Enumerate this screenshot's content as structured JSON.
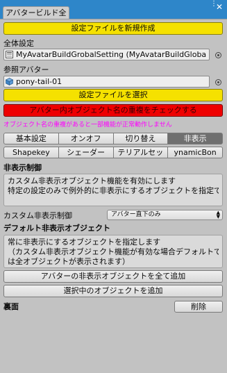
{
  "window": {
    "tab_title": "アバタービルド全",
    "close_glyph": "✕",
    "menu_glyph": "⋮"
  },
  "general": {
    "section_label": "全体設定",
    "new_settings_button": "設定ファイルを新規作成",
    "settings_file_value": "MyAvatarBuildGrobalSetting (MyAvatarBuildGloba"
  },
  "avatar": {
    "section_label": "参照アバター",
    "avatar_value": "pony-tail-01",
    "select_settings_button": "設定ファイルを選択",
    "check_duplicate_button": "アバター内オブジェクト名の重複をチェックする",
    "warning_text": "オブジェクト名の重複があると一部機能が正常動作しません"
  },
  "tabs_row1": [
    "基本設定",
    "オンオフ",
    "切り替え",
    "非表示"
  ],
  "tabs_row2": [
    "Shapekey",
    "シェーダー",
    "テリアルセッ",
    "ynamicBon"
  ],
  "active_tab": "非表示",
  "hide_control": {
    "title": "非表示制御",
    "help_lines": [
      "カスタム非表示オブジェクト機能を有効にします",
      "特定の設定のみで例外的に非表示にするオブジェクトを指定でき"
    ],
    "custom_label": "カスタム非表示制御",
    "custom_select_value": "アバター直下のみ",
    "select_arrows": "▲▼"
  },
  "default_hidden": {
    "title": "デフォルト非表示オブジェクト",
    "help_lines": [
      "常に非表示にするオブジェクトを指定します",
      "（カスタム非表示オブジェクト機能が有効な場合デフォルトで",
      "は全オブジェクトが表示されます）"
    ],
    "add_all_button": "アバターの非表示オブジェクトを全て追加",
    "add_selected_button": "選択中のオブジェクトを追加"
  },
  "back_face": {
    "label": "裏面",
    "delete_button": "削除"
  },
  "colors": {
    "title_bar": "#2e86c9",
    "panel": "#c2c2c2",
    "yellow_button": "#f5e100",
    "red_button": "#ee0000",
    "warning_text": "#ff00ff",
    "active_tab": "#6f6f6f"
  },
  "icons": {
    "settings_file_icon": "scriptable-object-icon",
    "avatar_icon": "cube-icon",
    "object_picker": "target-icon"
  }
}
